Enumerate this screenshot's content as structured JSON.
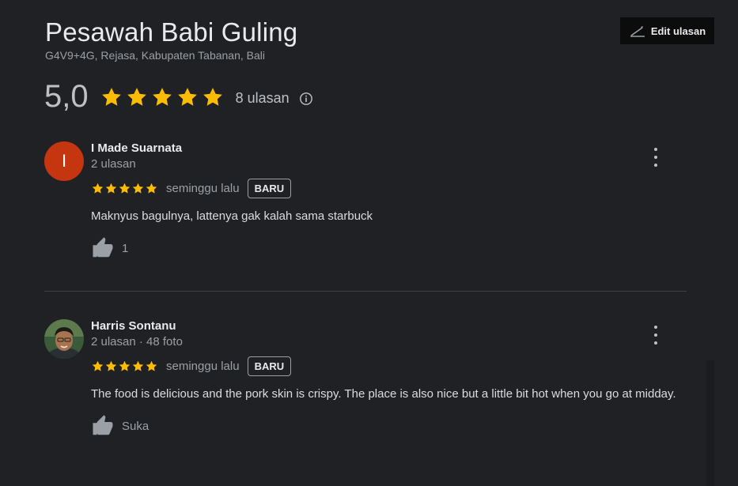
{
  "place": {
    "title": "Pesawah Babi Guling",
    "address": "G4V9+4G, Rejasa, Kabupaten Tabanan, Bali"
  },
  "edit_button": {
    "label": "Edit ulasan",
    "icon": "edit-pen-icon"
  },
  "rating": {
    "value": "5,0",
    "stars": 5,
    "count_label": "8 ulasan",
    "star_color": "#fbbc04"
  },
  "reviews": [
    {
      "name": "I Made Suarnata",
      "avatar_letter": "I",
      "avatar_color": "#c5350f",
      "meta": "2 ulasan",
      "stars": 5,
      "time": "seminggu lalu",
      "badge": "BARU",
      "text": "Maknyus bagulnya, lattenya gak kalah sama starbuck",
      "like_label": "1"
    },
    {
      "name": "Harris Sontanu",
      "avatar_type": "photo",
      "meta": "2 ulasan · 48 foto",
      "stars": 5,
      "time": "seminggu lalu",
      "badge": "BARU",
      "text": "The food is delicious and the pork skin is crispy. The place is also nice but a little bit hot when you go at midday.",
      "like_label": "Suka"
    }
  ]
}
